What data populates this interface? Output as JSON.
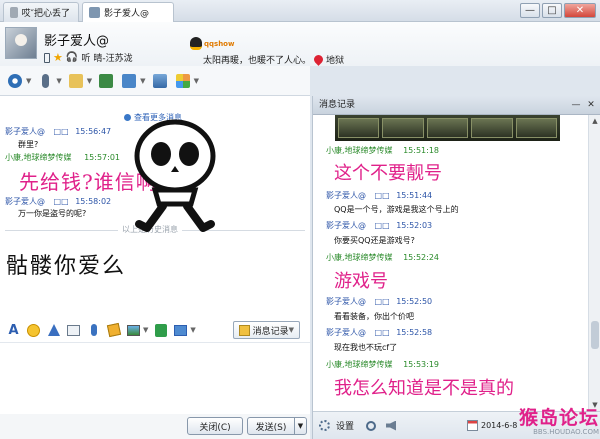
{
  "tabs": [
    {
      "label": "哎″把心丢了"
    },
    {
      "label": "影子爱人@"
    }
  ],
  "window": {
    "minimize": "—",
    "maximize": "□",
    "close": "✕"
  },
  "contact": {
    "nickname": "影子爱人@",
    "listening_prefix": "听",
    "song": "晴-汪苏泷",
    "qq_logo": "qqshow",
    "signature": "太阳再暖，也暖不了人心。",
    "location": "地狱"
  },
  "chat": {
    "more_messages": "查看更多消息",
    "messages": [
      {
        "sender": "影子爱人@",
        "badge": "□□",
        "time": "15:56:47",
        "text": "群里?",
        "sender_color": "blue"
      },
      {
        "sender": "小康,地球缔梦传媒",
        "badge": "",
        "time": "15:57:01",
        "text": "",
        "sender_color": "green"
      },
      {
        "sender": "影子爱人@",
        "badge": "□□",
        "time": "15:58:02",
        "text": "万一你是盗号的呢?",
        "sender_color": "blue"
      }
    ],
    "big_message": "先给钱?谁信啊",
    "divider_label": "以上是历史消息",
    "sticker_text": "骷髅你爱么"
  },
  "format_bar": {
    "history_button": "消息记录"
  },
  "buttons": {
    "close": "关闭(C)",
    "send": "发送(S)"
  },
  "history": {
    "title": "消息记录",
    "entries": [
      {
        "sender": "小康,地球缔梦传媒",
        "badge": "",
        "time": "15:51:18",
        "text": "这个不要靓号",
        "big": true,
        "color": "green"
      },
      {
        "sender": "影子爱人@",
        "badge": "□□",
        "time": "15:51:44",
        "text": "QQ是一个号，游戏是我这个号上的",
        "big": false,
        "color": "blue"
      },
      {
        "sender": "影子爱人@",
        "badge": "□□",
        "time": "15:52:03",
        "text": "你要买QQ还是游戏号?",
        "big": false,
        "color": "blue"
      },
      {
        "sender": "小康,地球缔梦传媒",
        "badge": "",
        "time": "15:52:24",
        "text": "游戏号",
        "big": true,
        "color": "green"
      },
      {
        "sender": "影子爱人@",
        "badge": "□□",
        "time": "15:52:50",
        "text": "看看装备，你出个价吧",
        "big": false,
        "color": "blue"
      },
      {
        "sender": "影子爱人@",
        "badge": "□□",
        "time": "15:52:58",
        "text": "现在我也不玩cf了",
        "big": false,
        "color": "blue"
      },
      {
        "sender": "小康,地球缔梦传媒",
        "badge": "",
        "time": "15:53:19",
        "text": "我怎么知道是不是真的",
        "big": true,
        "color": "green"
      }
    ],
    "settings": "设置",
    "date": "2014-6-8",
    "watermark": "猴岛论坛",
    "watermark_url": "BBS.HOUDAO.COM"
  }
}
